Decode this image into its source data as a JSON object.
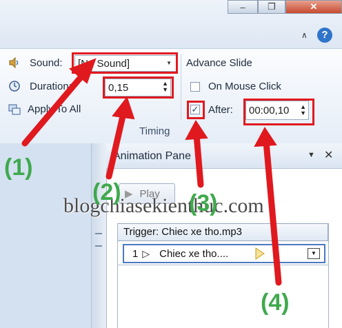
{
  "window": {
    "minimize_icon": "minimize-icon",
    "restore_icon": "restore-icon",
    "close_icon": "close-icon",
    "help_icon": "help-icon"
  },
  "ribbon": {
    "sound_label": "Sound:",
    "sound_value": "[No Sound]",
    "duration_label": "Duration:",
    "duration_value": "0,15",
    "apply_all_label": "Apply To All",
    "advance_slide_label": "Advance Slide",
    "on_mouse_click_label": "On Mouse Click",
    "on_mouse_click_checked": false,
    "after_label": "After:",
    "after_checked": true,
    "after_value": "00:00,10",
    "group_label": "Timing"
  },
  "animation_pane": {
    "title": "Animation Pane",
    "play_label": "Play",
    "trigger_label": "Trigger: Chiec xe tho.mp3",
    "item_number": "1",
    "item_label": "Chiec xe tho....",
    "close_icon": "close-icon",
    "dropdown_icon": "chevron-down-icon"
  },
  "annotations": {
    "label_1": "(1)",
    "label_2": "(2)",
    "label_3": "(3)",
    "label_4": "(4)",
    "arrow_color": "#e0191f",
    "label_color": "#3fa94d"
  },
  "watermark": "blogchiasekienthuc.com"
}
